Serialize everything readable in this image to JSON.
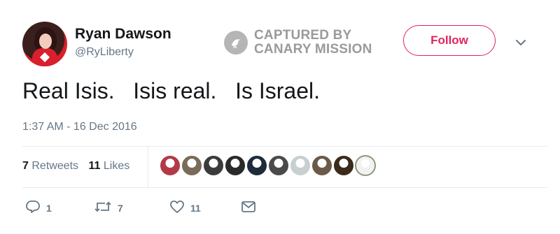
{
  "user": {
    "name": "Ryan Dawson",
    "handle": "@RyLiberty"
  },
  "watermark": {
    "line1": "CAPTURED BY",
    "line2": "CANARY MISSION"
  },
  "follow_label": "Follow",
  "tweet": {
    "text": "Real Isis.   Isis real.   Is Israel.",
    "timestamp": "1:37 AM - 16 Dec 2016"
  },
  "stats": {
    "retweets_count": "7",
    "retweets_label": "Retweets",
    "likes_count": "11",
    "likes_label": "Likes"
  },
  "likers": [
    {
      "color": "#b23a48"
    },
    {
      "color": "#7a6a58"
    },
    {
      "color": "#3b3b3b"
    },
    {
      "color": "#2a2a2a"
    },
    {
      "color": "#1e2b3a"
    },
    {
      "color": "#4a4a4a"
    },
    {
      "color": "#c7cfd1"
    },
    {
      "color": "#6b5a4a"
    },
    {
      "color": "#3a2b1c"
    },
    {
      "color": "#f2f2f2"
    }
  ],
  "actions": {
    "reply_count": "1",
    "retweet_count": "7",
    "like_count": "11"
  },
  "colors": {
    "accent": "#e0245e",
    "muted": "#657786",
    "text": "#14171a"
  }
}
